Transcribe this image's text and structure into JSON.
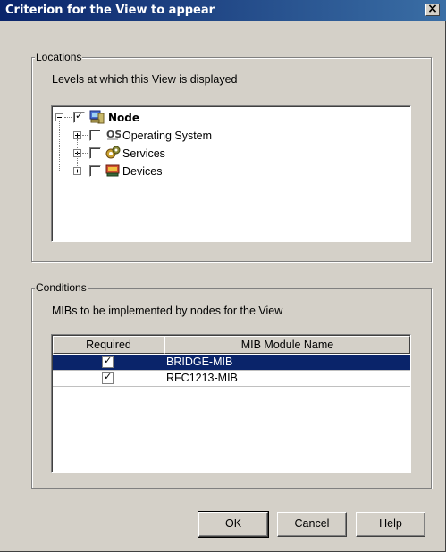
{
  "window": {
    "title": "Criterion for the View to appear",
    "close_glyph": "×"
  },
  "locations": {
    "legend": "Locations",
    "description": "Levels at which this View is displayed",
    "tree": [
      {
        "label": "Node",
        "checked": true,
        "expanded": true,
        "icon": "node-computer-icon",
        "bold": true
      },
      {
        "label": "Operating System",
        "checked": false,
        "expanded": false,
        "icon": "operating-system-icon"
      },
      {
        "label": "Services",
        "checked": false,
        "expanded": false,
        "icon": "services-gear-icon"
      },
      {
        "label": "Devices",
        "checked": false,
        "expanded": false,
        "icon": "devices-icon"
      }
    ]
  },
  "conditions": {
    "legend": "Conditions",
    "description": "MIBs to be implemented by nodes for the View",
    "columns": [
      "Required",
      "MIB Module Name"
    ],
    "rows": [
      {
        "required": true,
        "name": "BRIDGE-MIB",
        "selected": true
      },
      {
        "required": true,
        "name": "RFC1213-MIB",
        "selected": false
      }
    ]
  },
  "buttons": {
    "ok": "OK",
    "cancel": "Cancel",
    "help": "Help"
  },
  "colors": {
    "titlebar": "#0a246a",
    "dialog_bg": "#d4d0c8",
    "selection": "#0a246a"
  }
}
